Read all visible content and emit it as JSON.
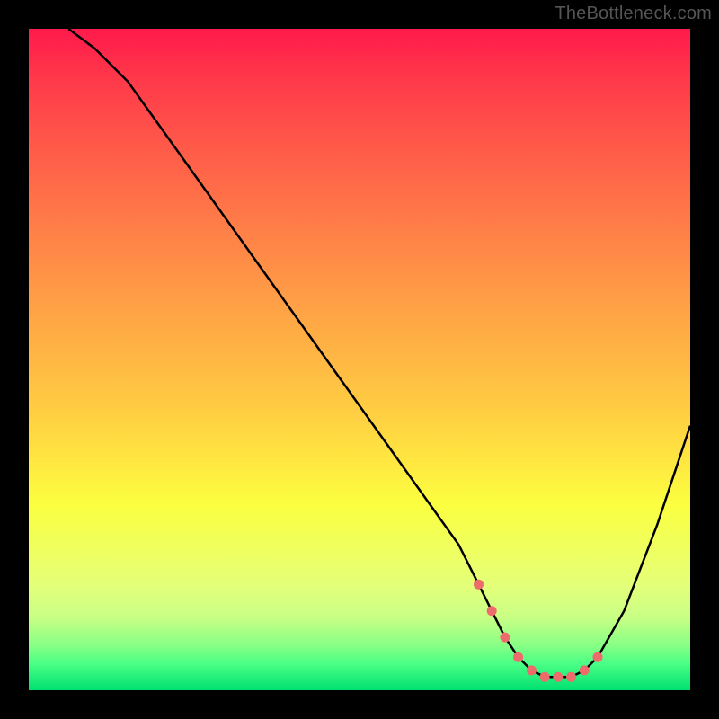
{
  "watermark": "TheBottleneck.com",
  "chart_data": {
    "type": "line",
    "title": "",
    "xlabel": "",
    "ylabel": "",
    "xlim": [
      0,
      100
    ],
    "ylim": [
      0,
      100
    ],
    "series": [
      {
        "name": "curve",
        "x": [
          6,
          10,
          15,
          20,
          25,
          30,
          35,
          40,
          45,
          50,
          55,
          60,
          65,
          68,
          70,
          72,
          74,
          76,
          78,
          80,
          82,
          84,
          86,
          90,
          95,
          100
        ],
        "y": [
          100,
          97,
          92,
          85,
          78,
          71,
          64,
          57,
          50,
          43,
          36,
          29,
          22,
          16,
          12,
          8,
          5,
          3,
          2,
          2,
          2,
          3,
          5,
          12,
          25,
          40
        ],
        "color": "#000000"
      }
    ],
    "markers": {
      "name": "highlight",
      "x": [
        68,
        70,
        72,
        74,
        76,
        78,
        80,
        82,
        84,
        86
      ],
      "y": [
        16,
        12,
        8,
        5,
        3,
        2,
        2,
        2,
        3,
        5
      ],
      "color": "#ee6b6b"
    },
    "gradient_stops": [
      {
        "pos": 0,
        "color": "#ff1a4b"
      },
      {
        "pos": 50,
        "color": "#ffc742"
      },
      {
        "pos": 80,
        "color": "#f5ff55"
      },
      {
        "pos": 100,
        "color": "#00e070"
      }
    ]
  }
}
